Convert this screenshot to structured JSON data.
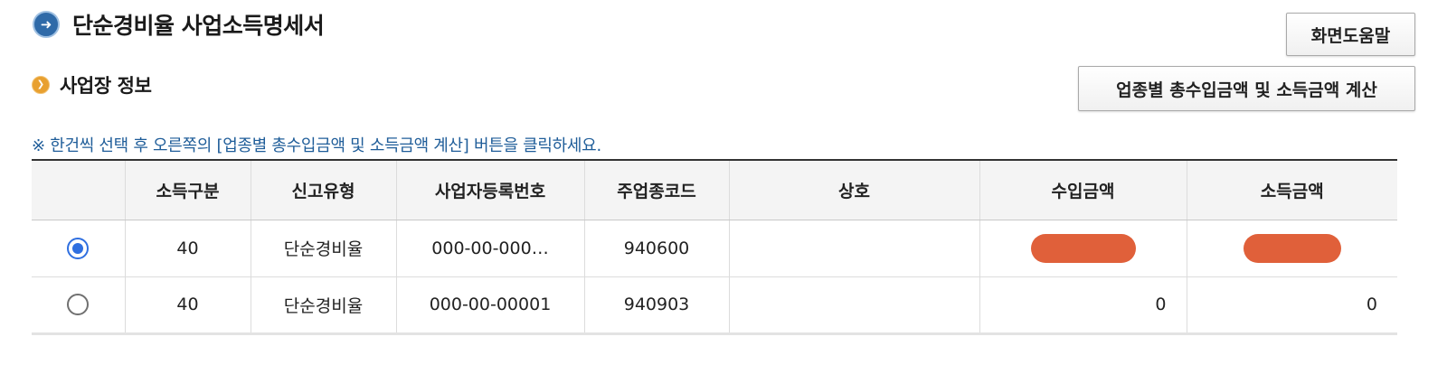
{
  "header": {
    "title": "단순경비율 사업소득명세서",
    "help_button_label": "화면도움말",
    "title_icon": "arrow-right-circle-icon"
  },
  "section": {
    "title": "사업장 정보",
    "calc_button_label": "업종별 총수입금액 및 소득금액 계산",
    "section_icon": "chevron-right-circle-icon"
  },
  "notice": "※ 한건씩 선택 후 오른쪽의 [업종별 총수입금액 및 소득금액 계산] 버튼을 클릭하세요.",
  "table": {
    "columns": [
      "",
      "소득구분",
      "신고유형",
      "사업자등록번호",
      "주업종코드",
      "상호",
      "수입금액",
      "소득금액"
    ],
    "rows": [
      {
        "selected": true,
        "income_type": "40",
        "report_type": "단순경비율",
        "business_number": "000-00-000…",
        "industry_code": "940600",
        "company_name": "",
        "revenue": "",
        "income": "",
        "redacted": true
      },
      {
        "selected": false,
        "income_type": "40",
        "report_type": "단순경비율",
        "business_number": "000-00-00001",
        "industry_code": "940903",
        "company_name": "",
        "revenue": "0",
        "income": "0",
        "redacted": false
      }
    ]
  },
  "colors": {
    "title_icon": "#2f6aa8",
    "section_icon": "#e8a030",
    "notice_text": "#1f5d99",
    "radio_selected": "#2f6fe0",
    "redaction": "#e0603a"
  }
}
